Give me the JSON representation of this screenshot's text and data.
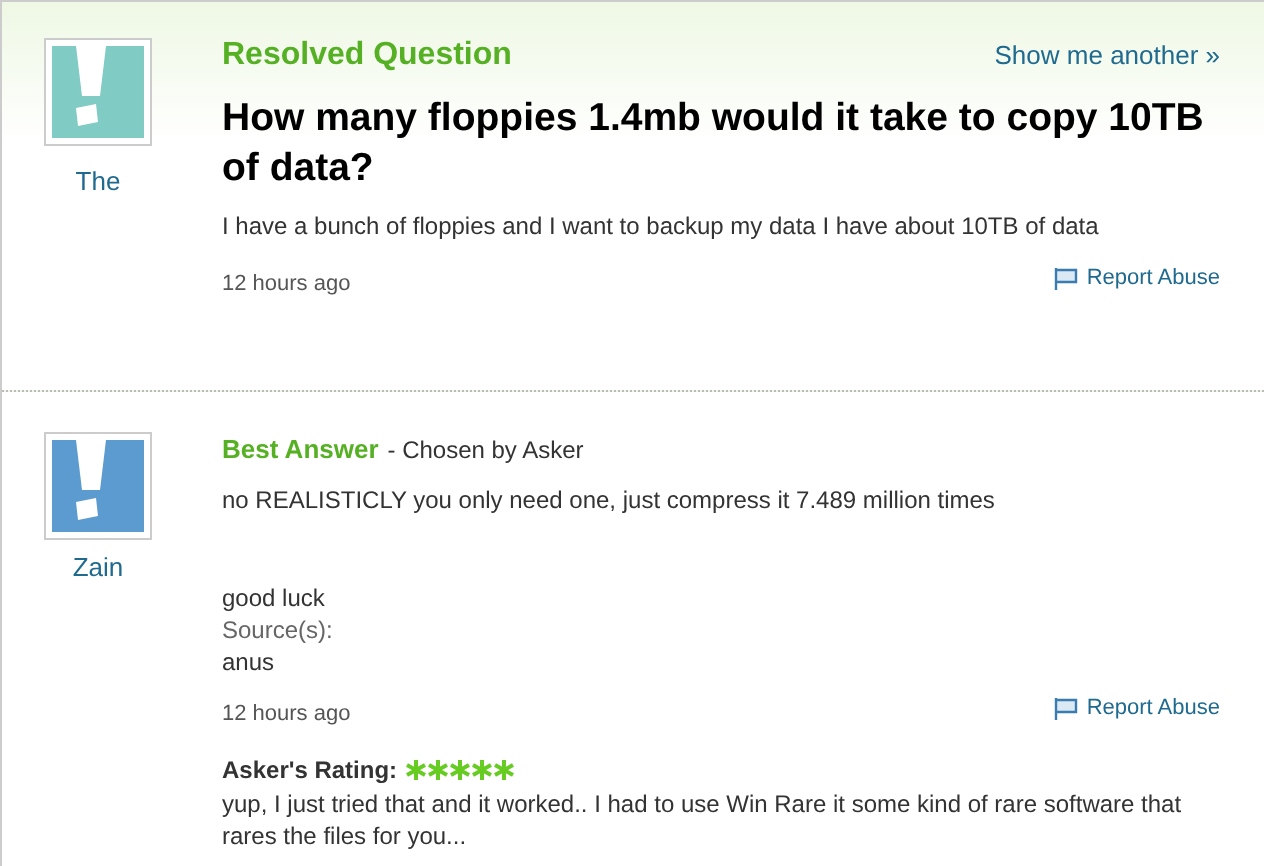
{
  "question": {
    "heading": "Resolved Question",
    "show_another": "Show me another »",
    "author": "The",
    "title": "How many floppies 1.4mb would it take to copy 10TB of data?",
    "body": "I have a bunch of floppies and I want to backup my data I have about 10TB of data",
    "time": "12 hours ago",
    "report": "Report Abuse"
  },
  "answer": {
    "heading": "Best Answer",
    "chosen": "- Chosen by Asker",
    "author": "Zain",
    "body": [
      "no REALISTICLY you only need one, just compress it 7.489 million times",
      "good luck"
    ],
    "source_label": "Source(s):",
    "source": "anus",
    "time": "12 hours ago",
    "report": "Report Abuse",
    "rating_label": "Asker's Rating:",
    "stars": 5,
    "comment": "yup, I just tried that and it worked.. I had to use Win Rare it some kind of rare software that rares the files for you..."
  }
}
